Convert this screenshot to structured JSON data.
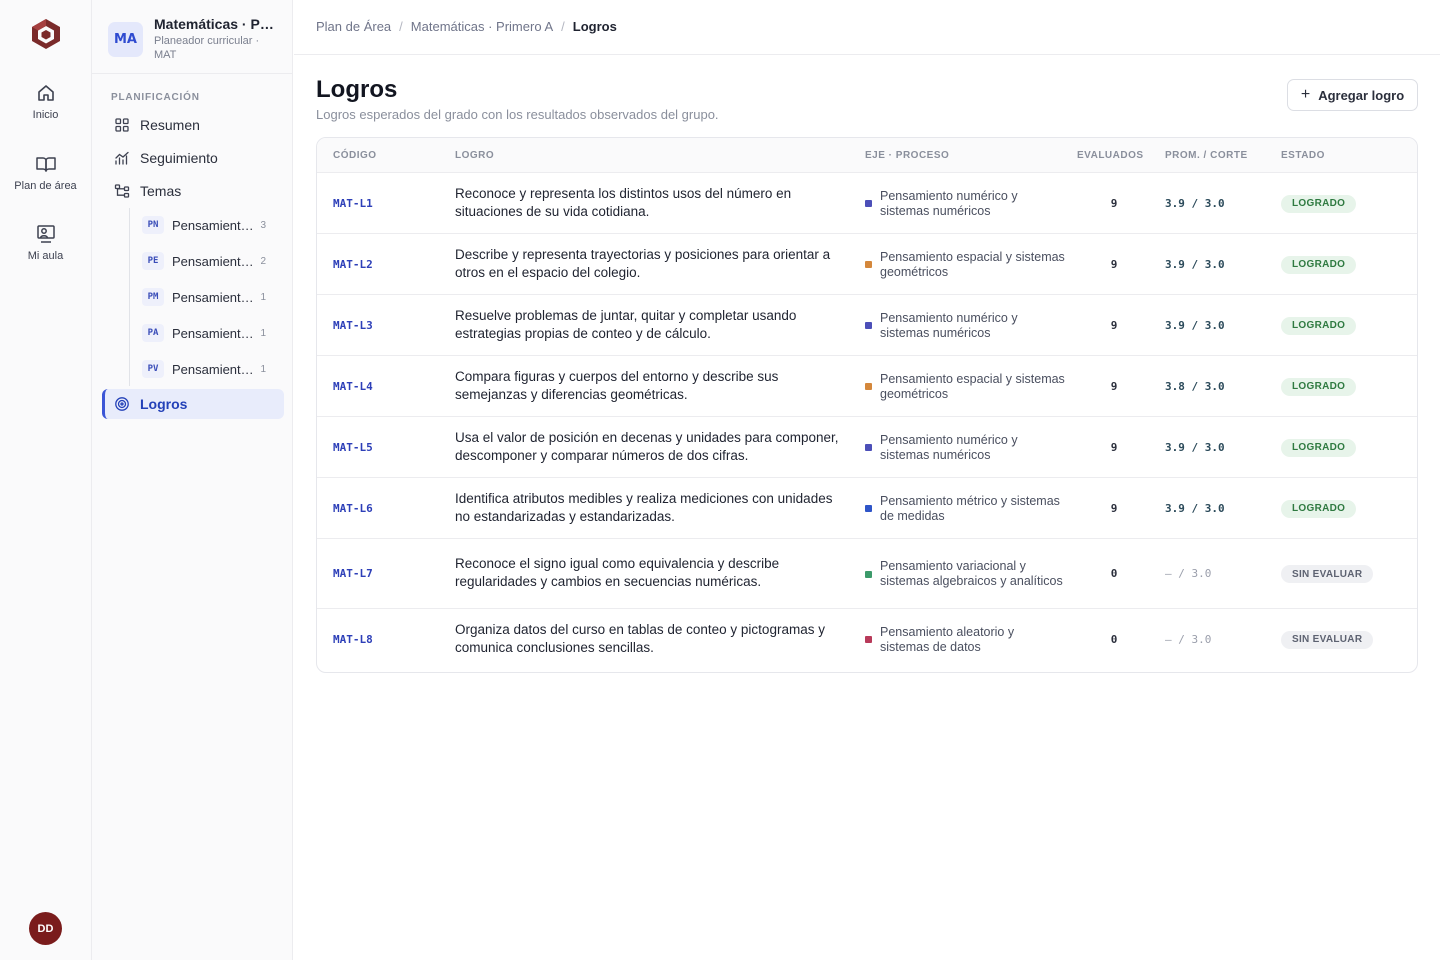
{
  "rail": {
    "items": [
      {
        "label": "Inicio",
        "icon": "home-icon"
      },
      {
        "label": "Plan de área",
        "icon": "book-icon"
      },
      {
        "label": "Mi aula",
        "icon": "classroom-icon"
      }
    ],
    "avatar": "DD"
  },
  "course": {
    "badge": "MA",
    "title": "Matemáticas · Pr…",
    "subtitle_line1": "Planeador curricular ·",
    "subtitle_line2": "MAT"
  },
  "sidebar": {
    "section_label": "PLANIFICACIÓN",
    "items": [
      {
        "label": "Resumen",
        "icon": "grid-icon"
      },
      {
        "label": "Seguimiento",
        "icon": "chart-icon"
      },
      {
        "label": "Temas",
        "icon": "tree-icon"
      }
    ],
    "topics": [
      {
        "code": "PN",
        "label": "Pensamient…",
        "count": "3"
      },
      {
        "code": "PE",
        "label": "Pensamient…",
        "count": "2"
      },
      {
        "code": "PM",
        "label": "Pensamient…",
        "count": "1"
      },
      {
        "code": "PA",
        "label": "Pensamient…",
        "count": "1"
      },
      {
        "code": "PV",
        "label": "Pensamient…",
        "count": "1"
      }
    ],
    "active_item": {
      "label": "Logros",
      "icon": "target-icon"
    }
  },
  "breadcrumb": {
    "items": [
      "Plan de Área",
      "Matemáticas · Primero A"
    ],
    "current": "Logros",
    "separator": "/"
  },
  "page": {
    "title": "Logros",
    "subtitle": "Logros esperados del grado con los resultados observados del grupo.",
    "add_button": "Agregar logro"
  },
  "table": {
    "headers": {
      "code": "CÓDIGO",
      "logro": "LOGRO",
      "eje": "EJE · PROCESO",
      "evaluados": "EVALUADOS",
      "prom": "PROM. / CORTE",
      "estado": "ESTADO"
    },
    "rows": [
      {
        "code": "MAT-L1",
        "desc": "Reconoce y representa los distintos usos del número en situaciones de su vida cotidiana.",
        "eje": "Pensamiento numérico y sistemas numéricos",
        "eje_color": "#4c4fb8",
        "evaluados": "9",
        "avg": "3.9 / 3.0",
        "status": "LOGRADO",
        "status_kind": "ok"
      },
      {
        "code": "MAT-L2",
        "desc": "Describe y representa trayectorias y posiciones para orientar a otros en el espacio del colegio.",
        "eje": "Pensamiento espacial y sistemas geométricos",
        "eje_color": "#d4873b",
        "evaluados": "9",
        "avg": "3.9 / 3.0",
        "status": "LOGRADO",
        "status_kind": "ok"
      },
      {
        "code": "MAT-L3",
        "desc": "Resuelve problemas de juntar, quitar y completar usando estrategias propias de conteo y de cálculo.",
        "eje": "Pensamiento numérico y sistemas numéricos",
        "eje_color": "#4c4fb8",
        "evaluados": "9",
        "avg": "3.9 / 3.0",
        "status": "LOGRADO",
        "status_kind": "ok"
      },
      {
        "code": "MAT-L4",
        "desc": "Compara figuras y cuerpos del entorno y describe sus semejanzas y diferencias geométricas.",
        "eje": "Pensamiento espacial y sistemas geométricos",
        "eje_color": "#d4873b",
        "evaluados": "9",
        "avg": "3.8 / 3.0",
        "status": "LOGRADO",
        "status_kind": "ok"
      },
      {
        "code": "MAT-L5",
        "desc": "Usa el valor de posición en decenas y unidades para componer, descomponer y comparar números de dos cifras.",
        "eje": "Pensamiento numérico y sistemas numéricos",
        "eje_color": "#4c4fb8",
        "evaluados": "9",
        "avg": "3.9 / 3.0",
        "status": "LOGRADO",
        "status_kind": "ok"
      },
      {
        "code": "MAT-L6",
        "desc": "Identifica atributos medibles y realiza mediciones con unidades no estandarizadas y estandarizadas.",
        "eje": "Pensamiento métrico y sistemas de medidas",
        "eje_color": "#2f55c8",
        "evaluados": "9",
        "avg": "3.9 / 3.0",
        "status": "LOGRADO",
        "status_kind": "ok"
      },
      {
        "code": "MAT-L7",
        "desc": "Reconoce el signo igual como equivalencia y describe regularidades y cambios en secuencias numéricas.",
        "eje": "Pensamiento variacional y sistemas algebraicos y analíticos",
        "eje_color": "#3c9a6a",
        "evaluados": "0",
        "avg": "— / 3.0",
        "status": "SIN EVALUAR",
        "status_kind": "none"
      },
      {
        "code": "MAT-L8",
        "desc": "Organiza datos del curso en tablas de conteo y pictogramas y comunica conclusiones sencillas.",
        "eje": "Pensamiento aleatorio y sistemas de datos",
        "eje_color": "#b83a5a",
        "evaluados": "0",
        "avg": "— / 3.0",
        "status": "SIN EVALUAR",
        "status_kind": "none"
      }
    ]
  }
}
